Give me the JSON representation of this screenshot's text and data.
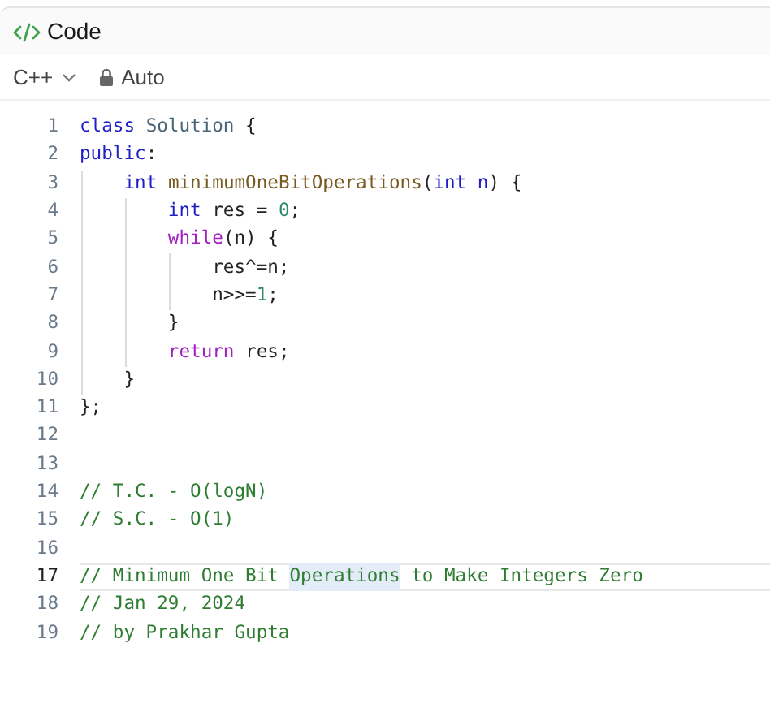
{
  "header": {
    "title": "Code"
  },
  "toolbar": {
    "language": "C++",
    "mode": "Auto"
  },
  "editor": {
    "lines": [
      {
        "number": "1",
        "selected": false,
        "tokens": [
          {
            "kind": "keyword",
            "text": "class"
          },
          {
            "kind": "type",
            "text": " Solution"
          },
          {
            "kind": "plain",
            "text": " {"
          }
        ]
      },
      {
        "number": "2",
        "selected": false,
        "tokens": [
          {
            "kind": "keyword",
            "text": "public"
          },
          {
            "kind": "plain",
            "text": ":"
          }
        ]
      },
      {
        "number": "3",
        "selected": false,
        "tokens": [
          {
            "kind": "keyword",
            "text": "    int"
          },
          {
            "kind": "function",
            "text": " minimumOneBitOperations"
          },
          {
            "kind": "plain",
            "text": "("
          },
          {
            "kind": "keyword",
            "text": "int"
          },
          {
            "kind": "param",
            "text": " n"
          },
          {
            "kind": "plain",
            "text": ") {"
          }
        ]
      },
      {
        "number": "4",
        "selected": false,
        "tokens": [
          {
            "kind": "keyword",
            "text": "        int"
          },
          {
            "kind": "plain",
            "text": " res = "
          },
          {
            "kind": "number",
            "text": "0"
          },
          {
            "kind": "plain",
            "text": ";"
          }
        ]
      },
      {
        "number": "5",
        "selected": false,
        "tokens": [
          {
            "kind": "control",
            "text": "        while"
          },
          {
            "kind": "plain",
            "text": "(n) {"
          }
        ]
      },
      {
        "number": "6",
        "selected": false,
        "tokens": [
          {
            "kind": "plain",
            "text": "            res^=n;"
          }
        ]
      },
      {
        "number": "7",
        "selected": false,
        "tokens": [
          {
            "kind": "plain",
            "text": "            n>>="
          },
          {
            "kind": "number",
            "text": "1"
          },
          {
            "kind": "plain",
            "text": ";"
          }
        ]
      },
      {
        "number": "8",
        "selected": false,
        "tokens": [
          {
            "kind": "plain",
            "text": "        }"
          }
        ]
      },
      {
        "number": "9",
        "selected": false,
        "tokens": [
          {
            "kind": "control",
            "text": "        return"
          },
          {
            "kind": "plain",
            "text": " res;"
          }
        ]
      },
      {
        "number": "10",
        "selected": false,
        "tokens": [
          {
            "kind": "plain",
            "text": "    }"
          }
        ]
      },
      {
        "number": "11",
        "selected": false,
        "tokens": [
          {
            "kind": "plain",
            "text": "};"
          }
        ]
      },
      {
        "number": "12",
        "selected": false
      },
      {
        "number": "13",
        "selected": false
      },
      {
        "number": "14",
        "selected": false,
        "tokens": [
          {
            "kind": "comment",
            "text": "// T.C. - O(logN)"
          }
        ]
      },
      {
        "number": "15",
        "selected": false,
        "tokens": [
          {
            "kind": "comment",
            "text": "// S.C. - O(1)"
          }
        ]
      },
      {
        "number": "16",
        "selected": false
      },
      {
        "number": "17",
        "selected": true,
        "tokens": [
          {
            "kind": "comment",
            "text": "// Minimum One Bit "
          },
          {
            "kind": "comment",
            "text": "Operations",
            "highlighted": true
          },
          {
            "kind": "comment",
            "text": " to Make Integers Zero"
          }
        ]
      },
      {
        "number": "18",
        "selected": false,
        "tokens": [
          {
            "kind": "comment",
            "text": "// Jan 29, 2024"
          }
        ]
      },
      {
        "number": "19",
        "selected": false,
        "tokens": [
          {
            "kind": "comment",
            "text": "// by Prakhar Gupta"
          }
        ]
      }
    ]
  }
}
